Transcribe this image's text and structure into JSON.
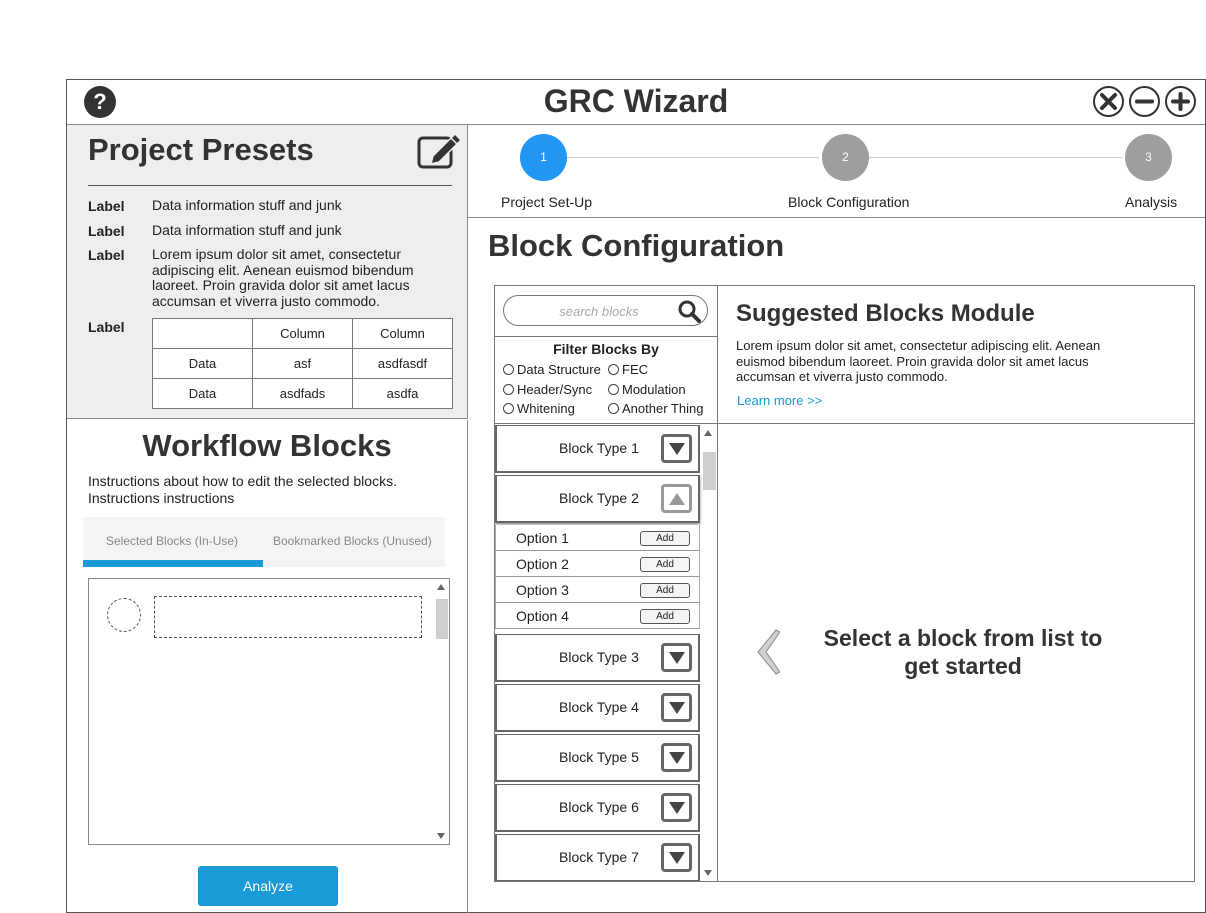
{
  "window": {
    "title": "GRC Wizard"
  },
  "icons": {
    "help": "question-circle-icon",
    "close": "close-icon",
    "minimize": "minus-icon",
    "maximize": "plus-icon",
    "edit": "edit-icon",
    "search": "search-icon"
  },
  "presets": {
    "title": "Project Presets",
    "rows": [
      {
        "label": "Label",
        "value": "Data information stuff and junk"
      },
      {
        "label": "Label",
        "value": "Data information stuff and junk"
      },
      {
        "label": "Label",
        "value": "Lorem ipsum dolor sit amet, consectetur adipiscing elit. Aenean euismod bibendum laoreet. Proin gravida dolor sit amet lacus accumsan et viverra justo commodo."
      },
      {
        "label": "Label",
        "value": ""
      }
    ],
    "table": {
      "header": [
        "",
        "Column",
        "Column"
      ],
      "rows": [
        [
          "Data",
          "asf",
          "asdfasdf"
        ],
        [
          "Data",
          "asdfads",
          "asdfa"
        ]
      ]
    }
  },
  "workflow": {
    "title": "Workflow Blocks",
    "instructions": "Instructions about how to edit the selected blocks. Instructions instructions",
    "tabs": [
      "Selected Blocks (In-Use)",
      "Bookmarked Blocks (Unused)"
    ],
    "active_tab": 0,
    "analyze_label": "Analyze"
  },
  "stepper": {
    "steps": [
      {
        "number": "1",
        "label": "Project Set-Up",
        "active": true
      },
      {
        "number": "2",
        "label": "Block Configuration",
        "active": false
      },
      {
        "number": "3",
        "label": "Analysis",
        "active": false
      }
    ],
    "active_color": "#2196f3",
    "inactive_color": "#9e9e9e"
  },
  "block_config": {
    "title": "Block Configuration",
    "search_placeholder": "search blocks",
    "filter_title": "Filter Blocks By",
    "filters": [
      "Data Structure",
      "FEC",
      "Header/Sync",
      "Modulation",
      "Whitening",
      "Another Thing"
    ],
    "blocks": [
      {
        "label": "Block Type 1",
        "expanded": false
      },
      {
        "label": "Block Type 2",
        "expanded": true
      },
      {
        "label": "Block Type 3",
        "expanded": false
      },
      {
        "label": "Block Type 4",
        "expanded": false
      },
      {
        "label": "Block Type 5",
        "expanded": false
      },
      {
        "label": "Block Type 6",
        "expanded": false
      },
      {
        "label": "Block Type 7",
        "expanded": false
      }
    ],
    "options": [
      "Option 1",
      "Option 2",
      "Option 3",
      "Option 4"
    ],
    "add_label": "Add"
  },
  "suggested": {
    "title": "Suggested Blocks Module",
    "text": "Lorem ipsum dolor sit amet, consectetur adipiscing elit. Aenean euismod bibendum laoreet. Proin gravida dolor sit amet lacus accumsan et viverra justo commodo.",
    "link": "Learn more >>"
  },
  "empty_state": {
    "message": "Select a block from list to get started"
  }
}
